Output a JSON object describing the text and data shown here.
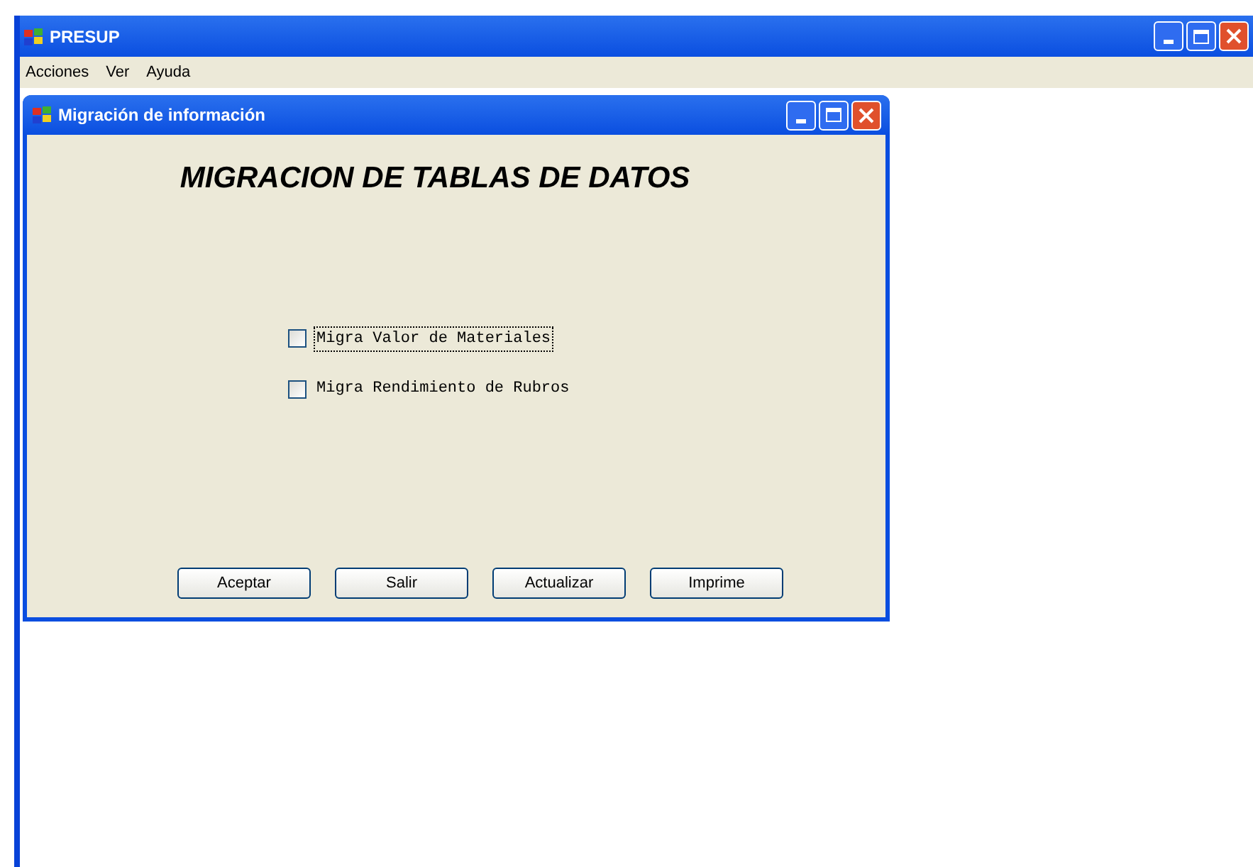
{
  "window": {
    "title": "PRESUP"
  },
  "menu": [
    "Acciones",
    "Ver",
    "Ayuda"
  ],
  "dialog": {
    "title": "Migración de información",
    "heading": "MIGRACION DE TABLAS DE DATOS",
    "options": [
      {
        "label": "Migra Valor de Materiales",
        "checked": false,
        "focused": true
      },
      {
        "label": "Migra Rendimiento de Rubros",
        "checked": false,
        "focused": false
      }
    ],
    "buttons": [
      "Aceptar",
      "Salir",
      "Actualizar",
      "Imprime"
    ]
  }
}
